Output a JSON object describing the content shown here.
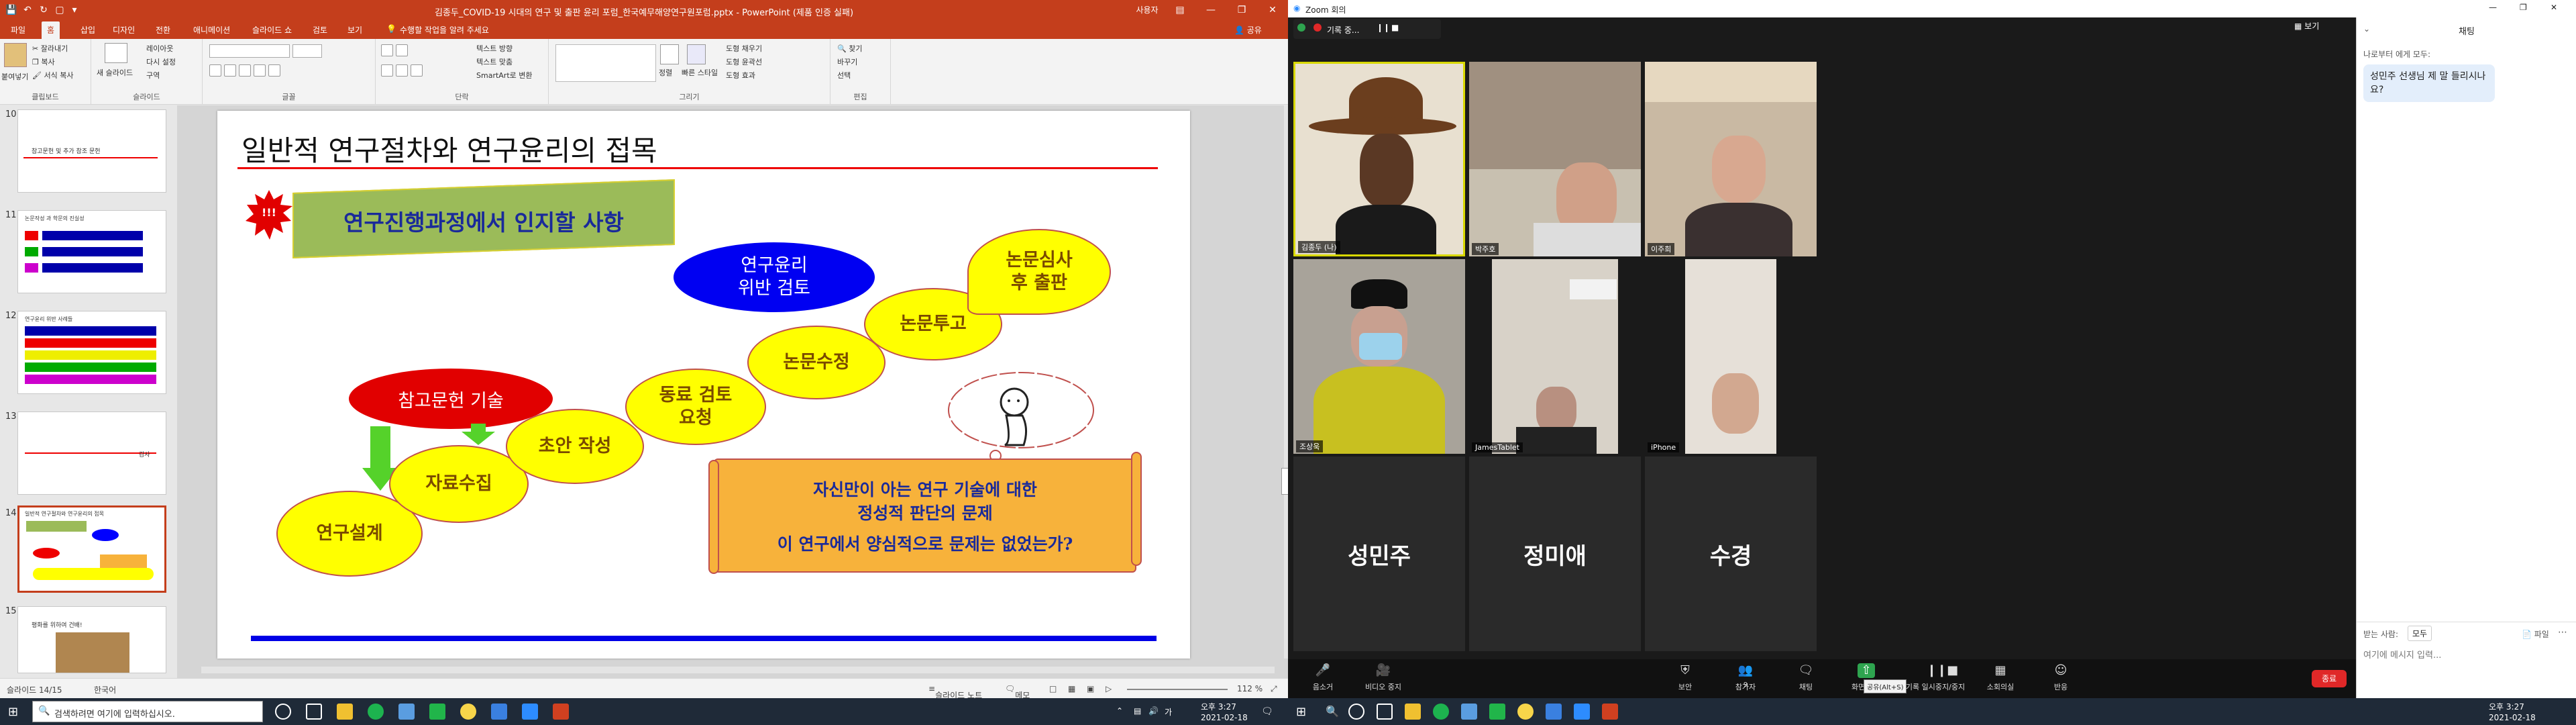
{
  "ppt": {
    "title": "김종두_COVID-19 시대의 연구 및 출판 윤리 포럼_한국예무해양연구원포럼.pptx - PowerPoint (제품 인증 실패)",
    "user_label": "사용자",
    "share_label": "공유",
    "tabs": [
      "파일",
      "홈",
      "삽입",
      "디자인",
      "전환",
      "애니메이션",
      "슬라이드 쇼",
      "검토",
      "보기",
      "수행할 작업을 알려 주세요"
    ],
    "ribbon": {
      "groups": [
        "클립보드",
        "슬라이드",
        "글꼴",
        "단락",
        "그리기",
        "편집"
      ],
      "paste_label": "붙여넣기",
      "cut_label": "잘라내기",
      "copy_label": "복사",
      "format_painter_label": "서식 복사",
      "new_slide_label": "새 슬라이드",
      "layout_label": "레이아웃",
      "reset_label": "다시 설정",
      "section_label": "구역",
      "text_direction_label": "텍스트 방향",
      "align_text_label": "텍스트 맞춤",
      "smartart_label": "SmartArt로 변환",
      "arrange_label": "정렬",
      "quick_styles_label": "빠른 스타일",
      "shape_fill_label": "도형 채우기",
      "shape_outline_label": "도형 윤곽선",
      "shape_effects_label": "도형 효과",
      "find_label": "찾기",
      "replace_label": "바꾸기",
      "select_label": "선택"
    },
    "thumbnails": [
      {
        "num": "10",
        "text": "참고문헌 및 추가 참조 문헌"
      },
      {
        "num": "11",
        "text": "논문작성 과 학문의 진실성"
      },
      {
        "num": "12",
        "text": "연구윤리 위반 사례들"
      },
      {
        "num": "13",
        "text": "감사"
      },
      {
        "num": "14",
        "text": "일반적 연구절차와 연구윤리의 접목"
      },
      {
        "num": "15",
        "text": "평화를 위하여 건배!"
      }
    ],
    "slide": {
      "title": "일반적 연구절차와 연구윤리의 접목",
      "badge": "!!!",
      "banner": "연구진행과정에서 인지할 사항",
      "ethics_review": "연구윤리\n위반 검토",
      "references": "참고문헌 기술",
      "steps": [
        "연구설계",
        "자료수집",
        "초안 작성",
        "동료 검토\n요청",
        "논문수정",
        "논문투고",
        "논문심사\n후 출판"
      ],
      "scroll_line1": "자신만이 아는 연구 기술에 대한",
      "scroll_line2": "정성적 판단의 문제",
      "scroll_line3": "이 연구에서 양심적으로 문제는 없었는가?"
    },
    "status": {
      "slide_counter": "슬라이드 14/15",
      "language": "한국어",
      "notes": "슬라이드 노트",
      "comments": "메모",
      "zoom": "112 %"
    }
  },
  "zoom": {
    "title": "Zoom 회의",
    "rec_label": "기록 중...",
    "view_label": "보기",
    "tiles": [
      {
        "name": "김종두 (나)"
      },
      {
        "name": "박주호"
      },
      {
        "name": "이주희"
      },
      {
        "name": "조상욱"
      },
      {
        "name": "JamesTablet"
      },
      {
        "name": "iPhone"
      },
      {
        "name": "성민주"
      },
      {
        "name": "정미애"
      },
      {
        "name": "수경"
      }
    ],
    "toolbar": [
      {
        "label": "음소거",
        "icon": "mic-icon"
      },
      {
        "label": "비디오 중지",
        "icon": "video-icon"
      },
      {
        "label": "보안",
        "icon": "shield-icon"
      },
      {
        "label": "참가자",
        "icon": "participants-icon"
      },
      {
        "label": "채팅",
        "icon": "chat-icon"
      },
      {
        "label": "화면 공유",
        "icon": "share-screen-icon"
      },
      {
        "label": "기록 일시중지/중지",
        "icon": "record-icon"
      },
      {
        "label": "소회의실",
        "icon": "breakout-icon"
      },
      {
        "label": "반응",
        "icon": "reactions-icon"
      }
    ],
    "participants_count": "9",
    "share_tooltip": "공유(Alt+S)",
    "end_label": "종료",
    "chat": {
      "header": "채팅",
      "from": "나로부터 에게 모두:",
      "message": "성민주 선생님 제 말 들리시나요?",
      "to_label": "받는 사람:",
      "to_value": "모두",
      "file_label": "파일",
      "placeholder": "여기에 메시지 입력..."
    }
  },
  "taskbar": {
    "search_placeholder": "검색하려면 여기에 입력하십시오.",
    "ime_label": "가",
    "time": "오후 3:27",
    "date": "2021-02-18"
  }
}
